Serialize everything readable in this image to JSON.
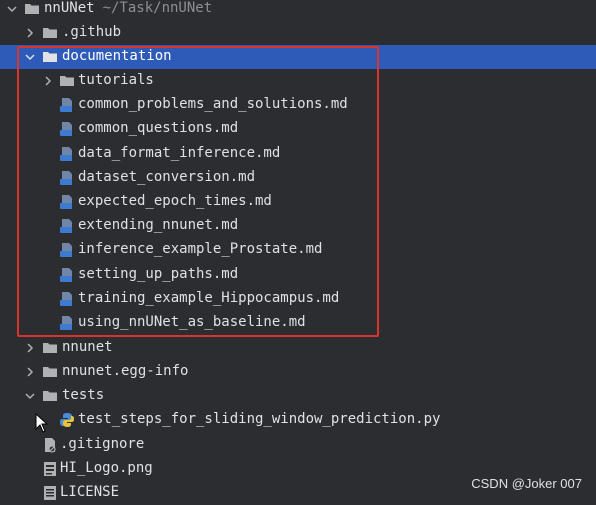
{
  "project": {
    "name": "nnUNet",
    "path": "~/Task/nnUNet"
  },
  "items": [
    {
      "label": ".github",
      "type": "folder"
    },
    {
      "label": "documentation",
      "type": "folder"
    },
    {
      "label": "tutorials",
      "type": "folder"
    },
    {
      "label": "common_problems_and_solutions.md",
      "type": "md"
    },
    {
      "label": "common_questions.md",
      "type": "md"
    },
    {
      "label": "data_format_inference.md",
      "type": "md"
    },
    {
      "label": "dataset_conversion.md",
      "type": "md"
    },
    {
      "label": "expected_epoch_times.md",
      "type": "md"
    },
    {
      "label": "extending_nnunet.md",
      "type": "md"
    },
    {
      "label": "inference_example_Prostate.md",
      "type": "md"
    },
    {
      "label": "setting_up_paths.md",
      "type": "md"
    },
    {
      "label": "training_example_Hippocampus.md",
      "type": "md"
    },
    {
      "label": "using_nnUNet_as_baseline.md",
      "type": "md"
    },
    {
      "label": "nnunet",
      "type": "folder"
    },
    {
      "label": "nnunet.egg-info",
      "type": "folder"
    },
    {
      "label": "tests",
      "type": "folder"
    },
    {
      "label": "test_steps_for_sliding_window_prediction.py",
      "type": "py"
    },
    {
      "label": ".gitignore",
      "type": "file"
    },
    {
      "label": "HI_Logo.png",
      "type": "image"
    },
    {
      "label": "LICENSE",
      "type": "file"
    }
  ],
  "watermark": "CSDN @Joker 007",
  "colors": {
    "selection": "#2e5bb8",
    "highlight_box": "#d9342a",
    "folder_icon": "#afb1b3",
    "md_icon": "#6f86a8",
    "py_icon": "#4b8bd6"
  }
}
